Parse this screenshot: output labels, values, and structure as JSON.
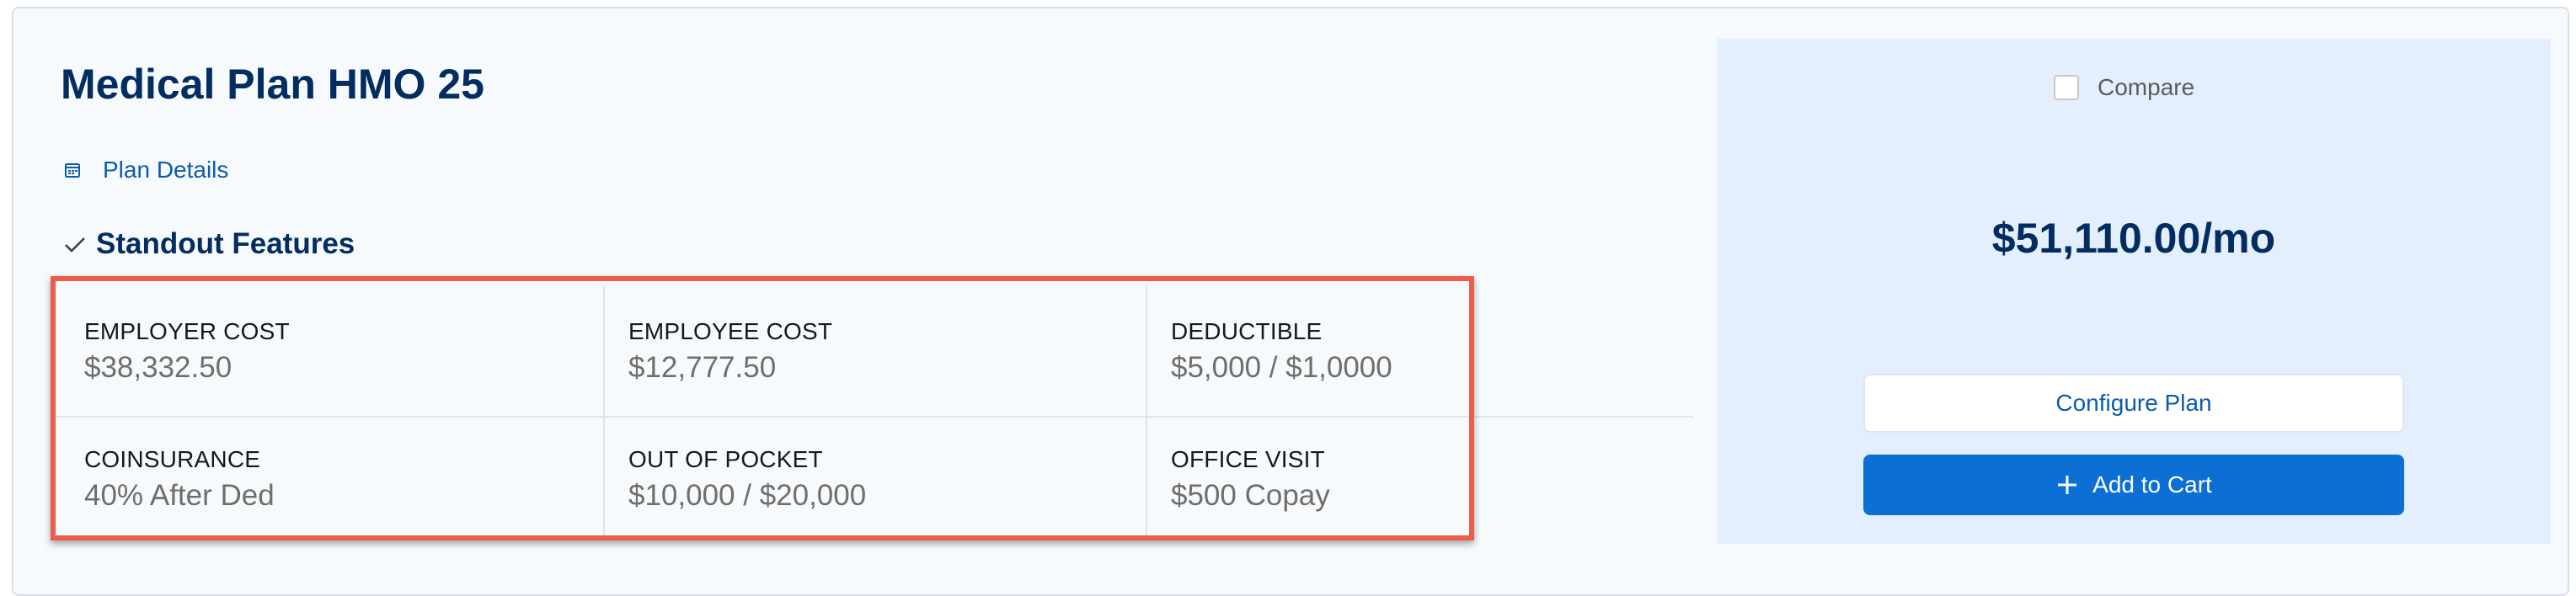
{
  "plan": {
    "title": "Medical Plan HMO 25",
    "details_link": "Plan Details",
    "standout_heading": "Standout Features"
  },
  "features": [
    {
      "label": "EMPLOYER COST",
      "value": "$38,332.50"
    },
    {
      "label": "EMPLOYEE COST",
      "value": "$12,777.50"
    },
    {
      "label": "DEDUCTIBLE",
      "value": "$5,000 / $1,0000"
    },
    {
      "label": "COINSURANCE",
      "value": "40% After Ded"
    },
    {
      "label": "OUT OF POCKET",
      "value": "$10,000 / $20,000"
    },
    {
      "label": "OFFICE VISIT",
      "value": "$500 Copay"
    }
  ],
  "side": {
    "compare_label": "Compare",
    "compare_checked": false,
    "price": "$51,110.00/mo",
    "configure_label": "Configure Plan",
    "add_to_cart_label": "Add to Cart"
  },
  "icons": {
    "details": "calendar-icon",
    "standout": "checkmark-icon",
    "cart": "plus-icon"
  },
  "colors": {
    "title": "#032d60",
    "link": "#0b5cab",
    "primary_button": "#0b6fd4",
    "side_panel": "#e3effd",
    "highlight_border": "#ec5d4b"
  }
}
